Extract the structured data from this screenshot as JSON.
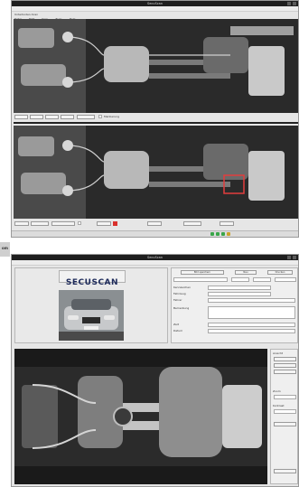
{
  "side_tag": {
    "label": "om"
  },
  "window1": {
    "title": "SecuScan",
    "menu": [
      "Datei",
      "Edit",
      "View",
      "Tools",
      "Help"
    ],
    "toolbar_label": "Unterboden-Scan",
    "buttons_bottom": [
      "Zoom",
      "Schritt",
      "Vergleich",
      "Speichern",
      "Alarm"
    ],
    "checkbox_label": "Markierung",
    "status_text": "Bereit"
  },
  "window2": {
    "title": "SecuScan",
    "menu": [
      "Datei",
      "Edit",
      "View",
      "Tools",
      "Help"
    ],
    "logo_text": "SECUSCAN",
    "header_buttons": [
      "Bild speichern",
      "Neu",
      "Drucken"
    ],
    "form_labels": [
      "Kennzeichen",
      "Fahrzeug",
      "Fahrer",
      "Bemerkung",
      "Zeit",
      "Datum"
    ],
    "right_panel_labels": [
      "Ansicht",
      "Zoom",
      "Kontrast"
    ],
    "status_text": "Bereit"
  },
  "colors": {
    "titlebar": "#1e1e1e",
    "window_bg": "#e6e6e6",
    "logo_bg": "#eeeeee",
    "logo_text": "#1d2a5a",
    "status_green": "#3aa64a"
  }
}
